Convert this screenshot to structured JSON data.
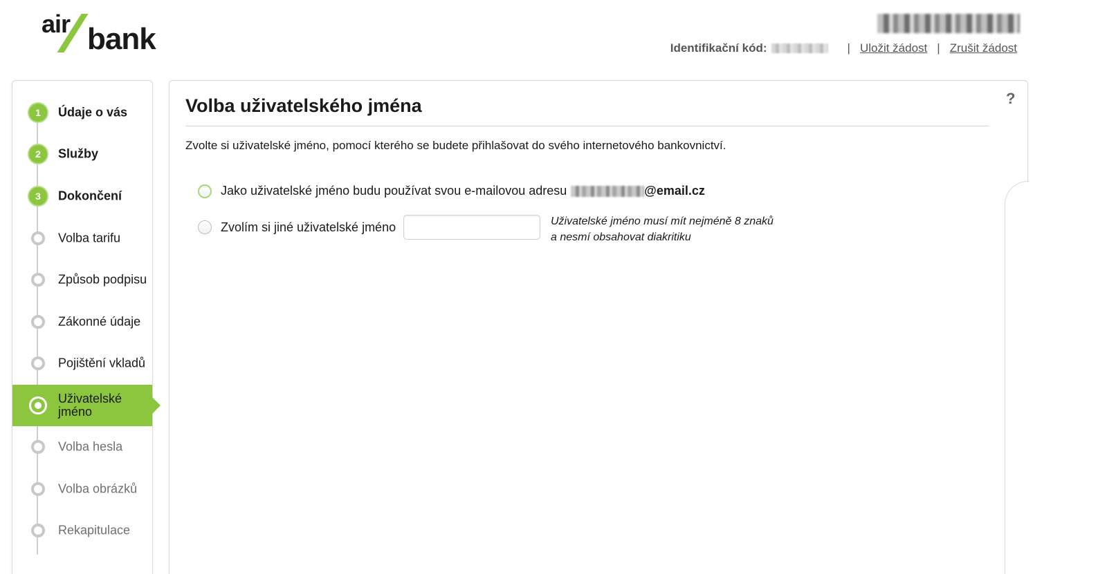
{
  "header": {
    "logo": {
      "part1": "air",
      "part2": "bank"
    },
    "id_label": "Identifikační kód:",
    "save_link": "Uložit žádost",
    "cancel_link": "Zrušit žádost",
    "separator": "|"
  },
  "sidebar": {
    "steps": [
      {
        "number": "1",
        "label": "Údaje o vás",
        "state": "done"
      },
      {
        "number": "2",
        "label": "Služby",
        "state": "done"
      },
      {
        "number": "3",
        "label": "Dokončení",
        "state": "done"
      },
      {
        "label": "Volba tarifu",
        "state": "completed"
      },
      {
        "label": "Způsob podpisu",
        "state": "completed"
      },
      {
        "label": "Zákonné údaje",
        "state": "completed"
      },
      {
        "label": "Pojištění vkladů",
        "state": "completed"
      },
      {
        "label": "Uživatelské jméno",
        "state": "current"
      },
      {
        "label": "Volba hesla",
        "state": "upcoming"
      },
      {
        "label": "Volba obrázků",
        "state": "upcoming"
      },
      {
        "label": "Rekapitulace",
        "state": "upcoming"
      }
    ]
  },
  "main": {
    "title": "Volba uživatelského jména",
    "help": "?",
    "intro": "Zvolte si uživatelské jméno, pomocí kterého se budete přihlašovat do svého internetového bankovnictví.",
    "option_email": {
      "label": "Jako uživatelské jméno budu používat svou e-mailovou adresu",
      "email_domain": "@email.cz",
      "selected": false
    },
    "option_custom": {
      "label": "Zvolím si jiné uživatelské jméno",
      "value": "",
      "selected": false
    },
    "hint_line1": "Uživatelské jméno musí mít nejméně 8 znaků",
    "hint_line2": "a nesmí obsahovat diakritiku"
  },
  "colors": {
    "accent": "#8cc63f",
    "text": "#1a1a1a",
    "muted": "#707070",
    "border": "#d9d9d9"
  }
}
